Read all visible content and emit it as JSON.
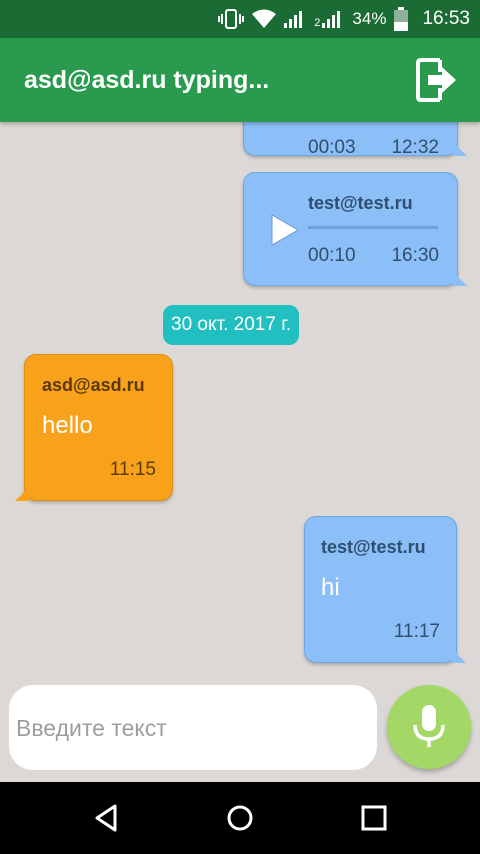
{
  "status_bar": {
    "battery": "34%",
    "time": "16:53",
    "sim2": "2"
  },
  "header": {
    "title": "asd@asd.ru typing..."
  },
  "messages": {
    "partial": {
      "duration": "00:03",
      "time": "12:32"
    },
    "voice": {
      "sender": "test@test.ru",
      "duration": "00:10",
      "time": "16:30"
    },
    "date_divider": "30 окт. 2017 г.",
    "incoming": {
      "sender": "asd@asd.ru",
      "text": "hello",
      "time": "11:15"
    },
    "outgoing": {
      "sender": "test@test.ru",
      "text": "hi",
      "time": "11:17"
    }
  },
  "composer": {
    "placeholder": "Введите текст"
  },
  "colors": {
    "appbar": "#2a9a4f",
    "statusbar": "#1b6b35",
    "blue_bubble": "#8cbef8",
    "orange_bubble": "#f8a11b",
    "date_chip": "#22bfc0",
    "mic_button": "#a3d867",
    "background": "#dcd8d5"
  }
}
